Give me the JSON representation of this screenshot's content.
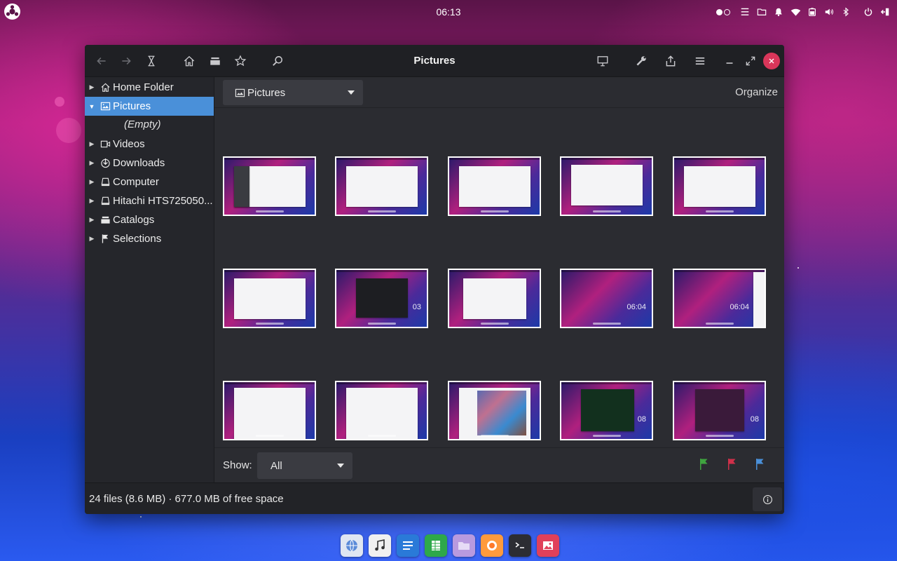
{
  "top_panel": {
    "clock": "06:13",
    "tray_icons": [
      "workspace-dots-icon",
      "notes-icon",
      "folder-icon",
      "bell-icon",
      "wifi-icon",
      "battery-icon",
      "volume-icon",
      "bluetooth-icon",
      "power-icon",
      "logout-icon"
    ]
  },
  "window": {
    "title": "Pictures",
    "toolbar_icons": [
      "back-arrow-icon",
      "forward-arrow-icon",
      "history-icon",
      "home-icon",
      "catalogs-icon",
      "bookmark-star-icon",
      "search-icon",
      "slideshow-icon",
      "preferences-icon",
      "share-icon",
      "menu-icon",
      "minimize-icon",
      "maximize-icon",
      "close-icon"
    ]
  },
  "sidebar": {
    "items": [
      {
        "label": "Home Folder",
        "icon": "home-icon",
        "expanded": false
      },
      {
        "label": "Pictures",
        "icon": "pictures-folder-icon",
        "expanded": true,
        "selected": true
      },
      {
        "label": "Videos",
        "icon": "videos-icon",
        "expanded": false
      },
      {
        "label": "Downloads",
        "icon": "downloads-icon",
        "expanded": false
      },
      {
        "label": "Computer",
        "icon": "computer-icon",
        "expanded": false
      },
      {
        "label": "Hitachi HTS725050...",
        "icon": "drive-icon",
        "expanded": false
      },
      {
        "label": "Catalogs",
        "icon": "catalogs-icon",
        "expanded": false
      },
      {
        "label": "Selections",
        "icon": "flag-icon",
        "expanded": false
      }
    ],
    "empty_label": "(Empty)"
  },
  "content": {
    "location": "Pictures",
    "organize_label": "Organize",
    "thumbnail_clocks": [
      "03",
      "06:04",
      "06:04",
      "08",
      "08"
    ],
    "show_label": "Show:",
    "show_value": "All",
    "flags": [
      {
        "name": "green-flag-icon",
        "color": "#3fa53f"
      },
      {
        "name": "red-flag-icon",
        "color": "#d0304a"
      },
      {
        "name": "blue-flag-icon",
        "color": "#4a90d9"
      }
    ]
  },
  "statusbar": {
    "text": "24 files (8.6 MB)  ·  677.0 MB of free space"
  },
  "dock": {
    "apps": [
      "browser-icon",
      "music-icon",
      "text-editor-icon",
      "spreadsheet-icon",
      "files-icon",
      "firefox-icon",
      "terminal-icon",
      "image-viewer-icon"
    ]
  },
  "colors": {
    "accent": "#4a90d9",
    "close_button": "#d9365a",
    "window_bg": "#25262b"
  }
}
